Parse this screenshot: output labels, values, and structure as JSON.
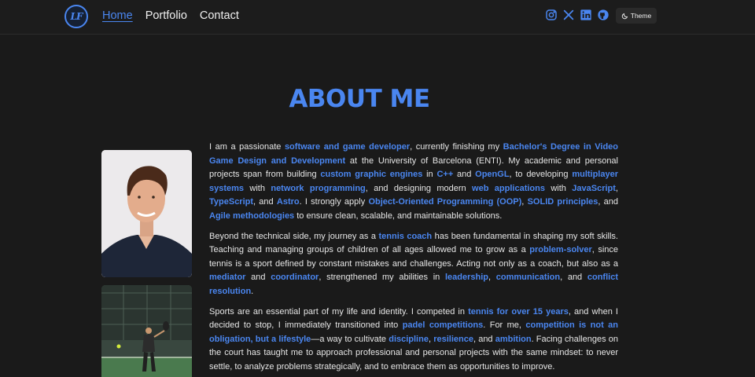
{
  "nav": {
    "logo_text": "LF",
    "links": [
      {
        "label": "Home",
        "active": true
      },
      {
        "label": "Portfolio",
        "active": false
      },
      {
        "label": "Contact",
        "active": false
      }
    ],
    "socials": [
      "instagram-icon",
      "x-icon",
      "linkedin-icon",
      "github-icon"
    ],
    "theme_label": "Theme"
  },
  "title": "ABOUT ME",
  "accent_color": "#4a86f0",
  "background_color": "#1a1a1a",
  "paragraphs": [
    [
      {
        "t": "I am a passionate "
      },
      {
        "t": "software and game developer",
        "h": true
      },
      {
        "t": ", currently finishing my "
      },
      {
        "t": "Bachelor's Degree in Video Game Design and Development",
        "h": true
      },
      {
        "t": " at the University of Barcelona (ENTI). My academic and personal projects span from building "
      },
      {
        "t": "custom graphic engines",
        "h": true
      },
      {
        "t": " in "
      },
      {
        "t": "C++",
        "h": true
      },
      {
        "t": " and "
      },
      {
        "t": "OpenGL",
        "h": true
      },
      {
        "t": ", to developing "
      },
      {
        "t": "multiplayer systems",
        "h": true
      },
      {
        "t": " with "
      },
      {
        "t": "network programming",
        "h": true
      },
      {
        "t": ", and designing modern "
      },
      {
        "t": "web applications",
        "h": true
      },
      {
        "t": " with "
      },
      {
        "t": "JavaScript",
        "h": true
      },
      {
        "t": ", "
      },
      {
        "t": "TypeScript",
        "h": true
      },
      {
        "t": ", and "
      },
      {
        "t": "Astro",
        "h": true
      },
      {
        "t": ". I strongly apply "
      },
      {
        "t": "Object-Oriented Programming (OOP)",
        "h": true
      },
      {
        "t": ", "
      },
      {
        "t": "SOLID principles",
        "h": true
      },
      {
        "t": ", and "
      },
      {
        "t": "Agile methodologies",
        "h": true
      },
      {
        "t": " to ensure clean, scalable, and maintainable solutions."
      }
    ],
    [
      {
        "t": "Beyond the technical side, my journey as a "
      },
      {
        "t": "tennis coach",
        "h": true
      },
      {
        "t": " has been fundamental in shaping my soft skills. Teaching and managing groups of children of all ages allowed me to grow as a "
      },
      {
        "t": "problem-solver",
        "h": true
      },
      {
        "t": ", since tennis is a sport defined by constant mistakes and challenges. Acting not only as a coach, but also as a "
      },
      {
        "t": "mediator",
        "h": true
      },
      {
        "t": " and "
      },
      {
        "t": "coordinator",
        "h": true
      },
      {
        "t": ", strengthened my abilities in "
      },
      {
        "t": "leadership",
        "h": true
      },
      {
        "t": ", "
      },
      {
        "t": "communication",
        "h": true
      },
      {
        "t": ", and "
      },
      {
        "t": "conflict resolution",
        "h": true
      },
      {
        "t": "."
      }
    ],
    [
      {
        "t": "Sports are an essential part of my life and identity. I competed in "
      },
      {
        "t": "tennis for over 15 years",
        "h": true
      },
      {
        "t": ", and when I decided to stop, I immediately transitioned into "
      },
      {
        "t": "padel competitions",
        "h": true
      },
      {
        "t": ". For me, "
      },
      {
        "t": "competition is not an obligation, but a lifestyle",
        "h": true
      },
      {
        "t": "—a way to cultivate "
      },
      {
        "t": "discipline",
        "h": true
      },
      {
        "t": ", "
      },
      {
        "t": "resilience",
        "h": true
      },
      {
        "t": ", and "
      },
      {
        "t": "ambition",
        "h": true
      },
      {
        "t": ". Facing challenges on the court has taught me to approach professional and personal projects with the same mindset: to never settle, to analyze problems strategically, and to embrace them as opportunities to improve."
      }
    ]
  ]
}
